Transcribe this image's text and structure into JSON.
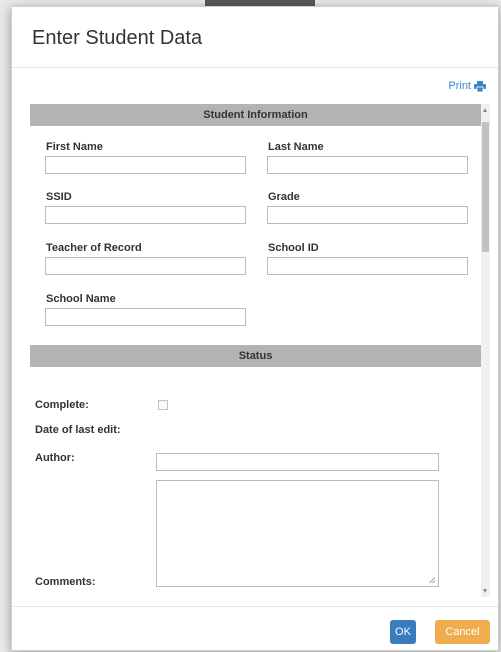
{
  "dialog": {
    "title": "Enter Student Data",
    "print_label": "Print"
  },
  "student_info": {
    "header": "Student Information",
    "first_name_label": "First Name",
    "last_name_label": "Last Name",
    "ssid_label": "SSID",
    "grade_label": "Grade",
    "teacher_label": "Teacher of Record",
    "school_id_label": "School ID",
    "school_name_label": "School Name",
    "first_name_value": "",
    "last_name_value": "",
    "ssid_value": "",
    "grade_value": "",
    "teacher_value": "",
    "school_id_value": "",
    "school_name_value": ""
  },
  "status": {
    "header": "Status",
    "complete_label": "Complete:",
    "complete_checked": false,
    "date_last_edit_label": "Date of last edit:",
    "author_label": "Author:",
    "author_value": "",
    "comments_label": "Comments:",
    "comments_value": ""
  },
  "footer": {
    "ok_label": "OK",
    "cancel_label": "Cancel"
  },
  "colors": {
    "section_header_bg": "#b3b3b3",
    "ok_button": "#3b7bbf",
    "cancel_button": "#f0ad4e",
    "link": "#3a86c8"
  },
  "icons": {
    "print": "printer-icon"
  }
}
